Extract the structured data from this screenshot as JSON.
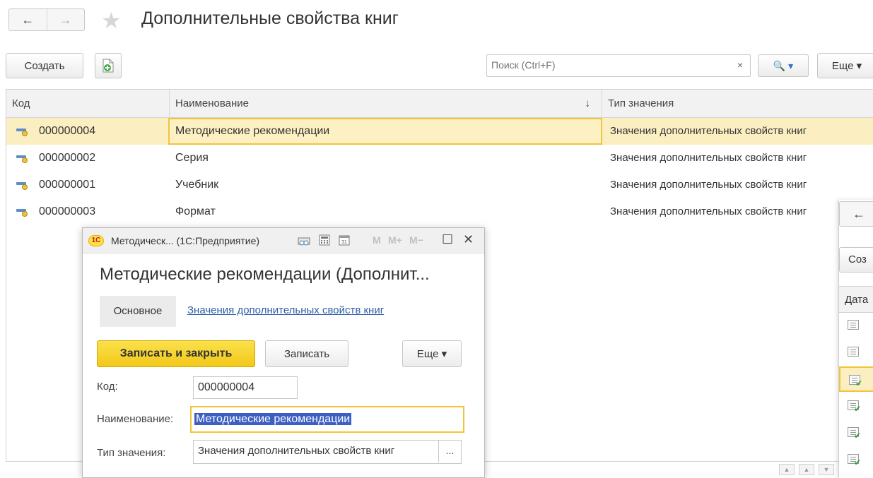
{
  "page": {
    "title": "Дополнительные свойства книг"
  },
  "nav": {
    "back": "←",
    "forward": "→",
    "favorite": "★"
  },
  "toolbar": {
    "create_label": "Создать",
    "search_placeholder": "Поиск (Ctrl+F)",
    "search_clear": "×",
    "search_button": "🔍 ▾",
    "more_label": "Еще ▾"
  },
  "table": {
    "columns": [
      "Код",
      "Наименование",
      "Тип значения"
    ],
    "sort_indicator": "↓",
    "rows": [
      {
        "code": "000000004",
        "name": "Методические рекомендации",
        "type": "Значения дополнительных свойств книг",
        "selected": true
      },
      {
        "code": "000000002",
        "name": "Серия",
        "type": "Значения дополнительных свойств книг"
      },
      {
        "code": "000000001",
        "name": "Учебник",
        "type": "Значения дополнительных свойств книг"
      },
      {
        "code": "000000003",
        "name": "Формат",
        "type": "Значения дополнительных свойств книг"
      }
    ]
  },
  "right_window": {
    "back": "←",
    "create_label": "Соз",
    "column_header": "Дата"
  },
  "modal": {
    "logo": "1С",
    "title": "Методическ... (1С:Предприятие)",
    "m_buttons": [
      "M",
      "M+",
      "M−"
    ],
    "maximize": "☐",
    "close": "✕",
    "heading": "Методические рекомендации (Дополнит...",
    "tab_main": "Основное",
    "tab_link": "Значения дополнительных свойств книг",
    "save_close_label": "Записать и закрыть",
    "save_label": "Записать",
    "more_label": "Еще ▾",
    "fields": {
      "code_label": "Код:",
      "code_value": "000000004",
      "name_label": "Наименование:",
      "name_value": "Методические рекомендации",
      "type_label": "Тип значения:",
      "type_value": "Значения дополнительных свойств книг",
      "type_choose": "..."
    }
  },
  "colors": {
    "accent_yellow": "#f2c43a",
    "selection_bg": "#fbefc2",
    "link_blue": "#2f5fa8",
    "text_selection": "#3c5fc4"
  }
}
